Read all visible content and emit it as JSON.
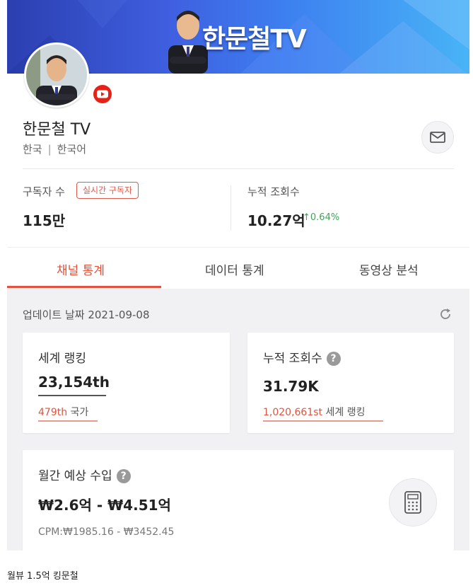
{
  "banner": {
    "title": "한문철TV"
  },
  "channel": {
    "name": "한문철 TV",
    "country": "한국",
    "language": "한국어"
  },
  "stats": {
    "subscribers_label": "구독자 수",
    "realtime_badge": "실시간 구독자",
    "subscribers_value": "115만",
    "views_label": "누적 조회수",
    "views_value": "10.27억",
    "views_change": "0.64%"
  },
  "tabs": [
    {
      "label": "채널 통계",
      "active": true
    },
    {
      "label": "데이터 통계",
      "active": false
    },
    {
      "label": "동영상 분석",
      "active": false
    }
  ],
  "update": {
    "label": "업데이트 날짜 2021-09-08"
  },
  "cards": {
    "world_rank": {
      "title": "세계 랭킹",
      "value": "23,154th",
      "sub_value": "479th",
      "sub_label": "국가"
    },
    "total_views": {
      "title": "누적 조회수",
      "value": "31.79K",
      "sub_value": "1,020,661st",
      "sub_label": "세계 랭킹"
    },
    "monthly_income": {
      "title": "월간 예상 수입",
      "value": "₩2.6억 - ₩4.51억",
      "cpm": "CPM:₩1985.16 - ₩3452.45"
    }
  },
  "caption": "월뷰 1.5억 킹문철",
  "colors": {
    "accent": "#e0533f",
    "positive": "#3aa757",
    "banner_start": "#2b3fb0",
    "banner_end": "#48b4f6"
  },
  "icons": [
    "youtube-icon",
    "mail-icon",
    "arrow-up-icon",
    "refresh-icon",
    "question-icon",
    "calculator-icon"
  ]
}
